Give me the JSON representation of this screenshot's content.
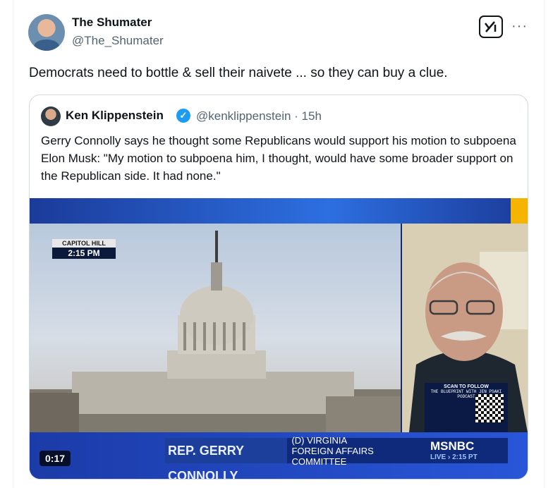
{
  "post": {
    "author_name": "The Shumater",
    "author_handle": "@The_Shumater",
    "text": "Democrats need to bottle & sell their naivete ... so they can buy a clue.",
    "more_label": "···"
  },
  "quote": {
    "author_name": "Ken Klippenstein",
    "author_handle": "@kenklippenstein · 15h",
    "verified": true,
    "text": "Gerry Connolly says he thought some Republicans would support his motion to subpoena Elon Musk: \"My motion to subpoena him, I thought, would have some broader support on the Republican side. It had none.\""
  },
  "video": {
    "location_label": "CAPITOL HILL",
    "time_label": "2:15 PM",
    "chyron_name": "REP. GERRY CONNOLLY",
    "chyron_line1": "(D) VIRGINIA",
    "chyron_line2": "FOREIGN AFFAIRS COMMITTEE",
    "network": "MSNBC",
    "live_label": "LIVE › 2:15 PT",
    "scan_title": "SCAN TO FOLLOW",
    "scan_podcast": "THE BLUEPRINT WITH JEN PSAKI PODCAST",
    "timestamp": "0:17"
  },
  "colors": {
    "verified": "#1d9bf0",
    "muted_text": "#536471",
    "border": "#cfd9de"
  }
}
